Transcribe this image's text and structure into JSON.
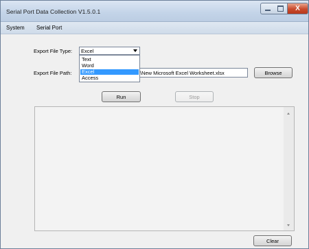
{
  "window": {
    "title": "Serial Port Data Collection  V1.5.0.1",
    "close_glyph": "X"
  },
  "menu": {
    "items": [
      "System",
      "Serial Port"
    ]
  },
  "form": {
    "export_type_label": "Export File Type:",
    "export_type_value": "Excel",
    "export_type_options": [
      "Text",
      "Word",
      "Excel",
      "Access"
    ],
    "export_type_selected_option": "Excel",
    "export_path_label": "Export File Path:",
    "export_path_value": "\\New Microsoft Excel Worksheet.xlsx",
    "browse_label": "Browse",
    "run_label": "Run",
    "stop_label": "Stop"
  },
  "log": {
    "clear_label": "Clear"
  },
  "colors": {
    "selection": "#3399ff",
    "close_button": "#c94a2c"
  },
  "icons": [
    "minimize-icon",
    "maximize-icon",
    "close-icon",
    "chevron-down-icon",
    "scroll-up-icon",
    "scroll-down-icon"
  ]
}
